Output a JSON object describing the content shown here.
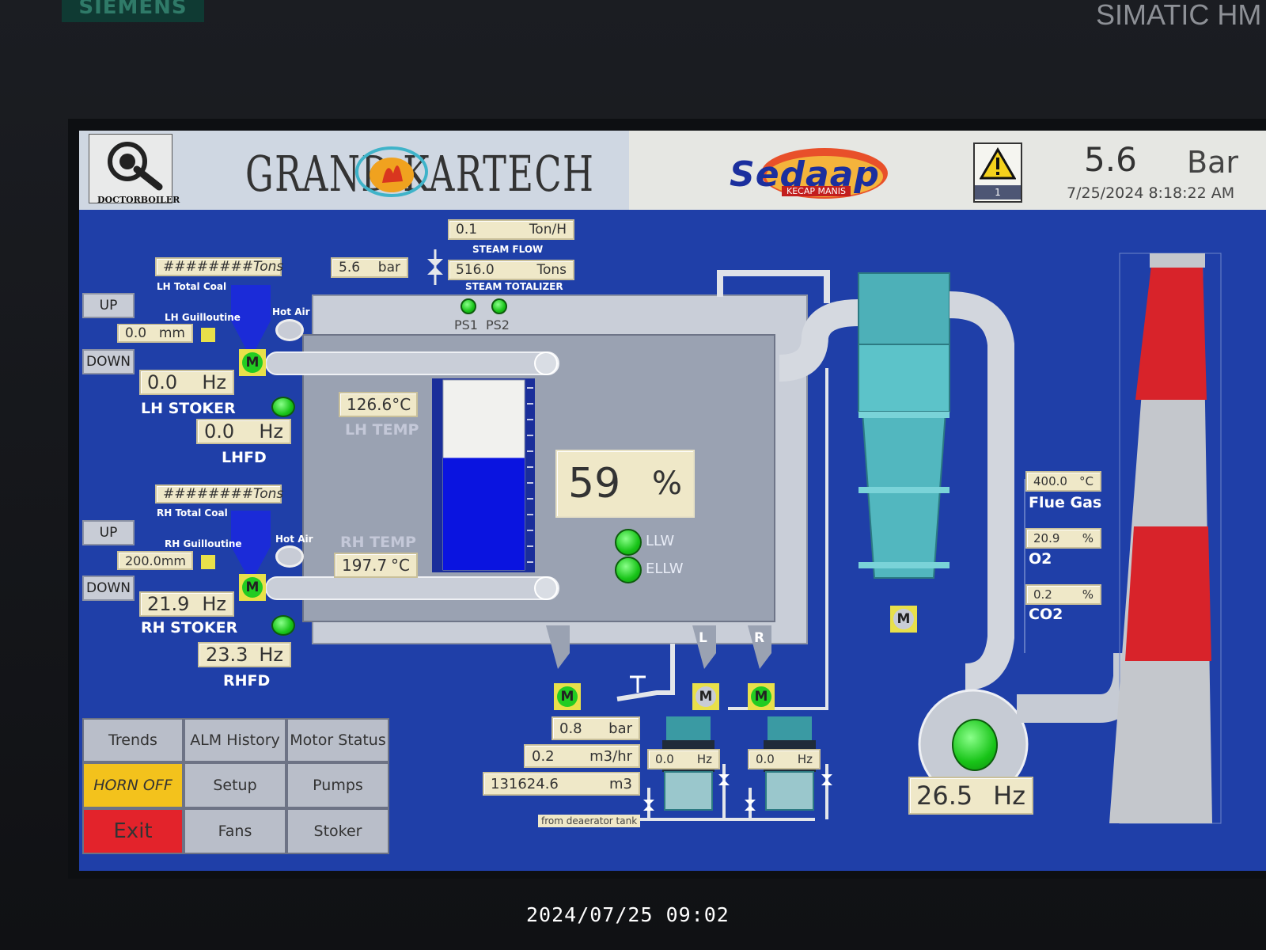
{
  "device": {
    "brand": "SIEMENS",
    "model": "SIMATIC HM"
  },
  "header": {
    "logo_small_text": "DOCTORBOILER",
    "company": "GRAND KARTECH",
    "client_logo": "Sedaap",
    "client_logo_sub": "KECAP MANIS",
    "alarm_count": "1",
    "pressure_value": "5.6",
    "pressure_unit": "Bar",
    "datetime": "7/25/2024 8:18:22 AM"
  },
  "steam": {
    "flow_value": "0.1",
    "flow_unit": "Ton/H",
    "flow_label": "STEAM FLOW",
    "total_value": "516.0",
    "total_unit": "Tons",
    "total_label": "STEAM TOTALIZER",
    "pressure_value": "5.6",
    "pressure_unit": "bar",
    "ps1": "PS1",
    "ps2": "PS2"
  },
  "lh": {
    "total_coal": "########",
    "total_coal_unit": "Tons",
    "total_coal_label": "LH Total Coal",
    "up": "UP",
    "down": "DOWN",
    "guillotine_label": "LH Guilloutine",
    "guillotine_value": "0.0",
    "guillotine_unit": "mm",
    "hot_air": "Hot Air",
    "stoker_value": "0.0",
    "stoker_unit": "Hz",
    "stoker_label": "LH STOKER",
    "fd_value": "0.0",
    "fd_unit": "Hz",
    "fd_label": "LHFD",
    "temp_value": "126.6",
    "temp_unit": "°C",
    "temp_label": "LH TEMP"
  },
  "rh": {
    "total_coal": "########",
    "total_coal_unit": "Tons",
    "total_coal_label": "RH Total Coal",
    "up": "UP",
    "down": "DOWN",
    "guillotine_label": "RH Guilloutine",
    "guillotine_value": "200.0",
    "guillotine_unit": "mm",
    "hot_air": "Hot Air",
    "stoker_value": "21.9",
    "stoker_unit": "Hz",
    "stoker_label": "RH STOKER",
    "fd_value": "23.3",
    "fd_unit": "Hz",
    "fd_label": "RHFD",
    "temp_value": "197.7",
    "temp_unit": "°C",
    "temp_label": "RH TEMP"
  },
  "drum": {
    "level_value": "59",
    "level_unit": "%",
    "level_fraction": 0.59,
    "llw": "LLW",
    "ellw": "ELLW"
  },
  "motor_label": "M",
  "ash": {
    "left": "L",
    "right": "R"
  },
  "feedwater": {
    "pressure_value": "0.8",
    "pressure_unit": "bar",
    "flow_value": "0.2",
    "flow_unit": "m3/hr",
    "total_value": "131624.6",
    "total_unit": "m3",
    "source": "from deaerator tank",
    "pump1_value": "0.0",
    "pump1_unit": "Hz",
    "pump2_value": "0.0",
    "pump2_unit": "Hz"
  },
  "flue": {
    "temp_value": "400.0",
    "temp_unit": "°C",
    "temp_label": "Flue Gas",
    "o2_value": "20.9",
    "o2_unit": "%",
    "o2_label": "O2",
    "co2_value": "0.2",
    "co2_unit": "%",
    "co2_label": "CO2"
  },
  "id_fan": {
    "value": "26.5",
    "unit": "Hz"
  },
  "menu": {
    "trends": "Trends",
    "alm_history": "ALM History",
    "motor_status": "Motor Status",
    "horn_off": "HORN OFF",
    "setup": "Setup",
    "pumps": "Pumps",
    "exit": "Exit",
    "fans": "Fans",
    "stoker": "Stoker"
  },
  "camera_timestamp": "2024/07/25 09:02",
  "colors": {
    "panel_bg": "#1f3fa8",
    "value_box": "#efe8c8",
    "motor_on": "#22cc22",
    "motor_frame": "#e8e04a",
    "horn": "#f3c21c",
    "exit": "#e3232b",
    "water": "#0a14e0"
  }
}
